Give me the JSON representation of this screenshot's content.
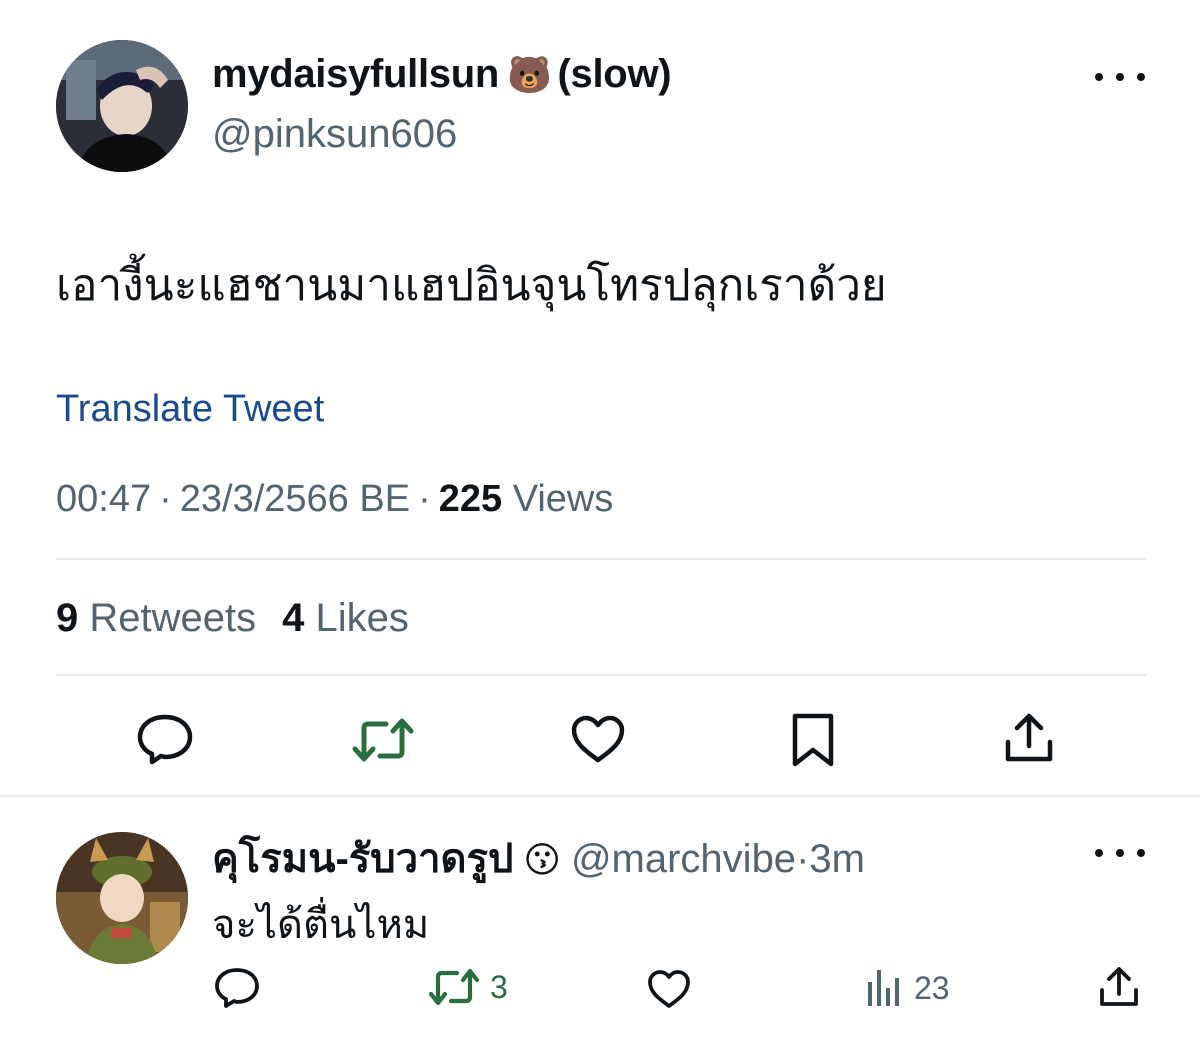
{
  "tweet": {
    "display_name": "mydaisyfullsun",
    "name_emoji": "🐻",
    "name_suffix": "(slow)",
    "handle": "@pinksun606",
    "text": "เอางี้นะแฮชานมาแฮปอินจุนโทรปลุกเราด้วย",
    "translate_label": "Translate Tweet",
    "time": "00:47",
    "date": "23/3/2566 BE",
    "views_count": "225",
    "views_label": "Views",
    "retweets_count": "9",
    "retweets_label": "Retweets",
    "likes_count": "4",
    "likes_label": "Likes",
    "separator": "·"
  },
  "reply": {
    "display_name": "คุโรมน-รับวาดรูป",
    "name_emoji": "😗",
    "handle": "@marchvibe",
    "time": "3m",
    "separator": "·",
    "text": "จะได้ตื่นไหม",
    "retweets_count": "3",
    "views_count": "23"
  },
  "colors": {
    "text_primary": "#0f1419",
    "text_secondary": "#536471",
    "link": "#1a4b8c",
    "retweet_green": "#2a6e3f",
    "divider": "#e6e9eb"
  },
  "icons": {
    "tweet_actions": [
      "reply-icon",
      "retweet-icon",
      "like-icon",
      "bookmark-icon",
      "share-icon"
    ],
    "reply_actions": [
      "reply-icon",
      "retweet-icon",
      "like-icon",
      "views-icon",
      "share-icon"
    ],
    "more": "more-icon"
  }
}
